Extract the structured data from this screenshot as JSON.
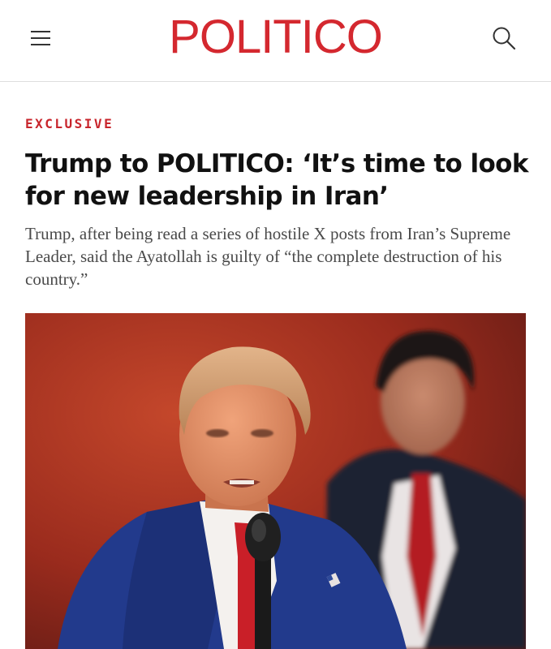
{
  "header": {
    "logo_text": "POLITICO",
    "brand_color": "#d4282f",
    "menu_icon": "hamburger-menu-icon",
    "search_icon": "search-icon"
  },
  "article": {
    "kicker": "EXCLUSIVE",
    "headline": "Trump to POLITICO: ‘It’s time to look for new leadership in Iran’",
    "dek": "Trump, after being read a series of hostile X posts from Iran’s Supreme Leader, said the Ayatollah is guilty of “the complete destruction of his country.”"
  }
}
